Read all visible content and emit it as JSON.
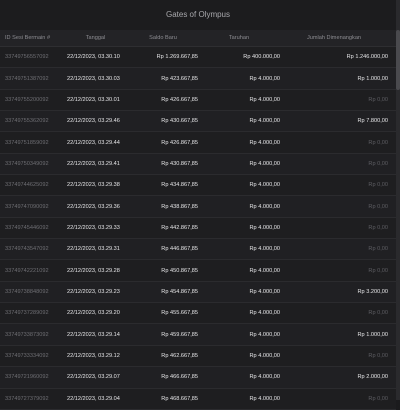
{
  "window": {
    "title": "Gates of Olympus"
  },
  "table": {
    "headers": [
      "ID Sesi Bermain #",
      "Tanggal",
      "Saldo Baru",
      "Taruhan",
      "Jumlah Dimenangkan"
    ],
    "rows": [
      [
        "33749756557092",
        "22/12/2023, 03.30.10",
        "Rp 1.269.667,85",
        "Rp 400.000,00",
        "Rp 1.246.000,00"
      ],
      [
        "33749751387092",
        "22/12/2023, 03.30.03",
        "Rp 423.667,85",
        "Rp 4.000,00",
        "Rp 1.000,00"
      ],
      [
        "33749755200092",
        "22/12/2023, 03.30.01",
        "Rp 426.667,85",
        "Rp 4.000,00",
        "Rp 0,00"
      ],
      [
        "33749755362092",
        "22/12/2023, 03.29.46",
        "Rp 430.667,85",
        "Rp 4.000,00",
        "Rp 7.800,00"
      ],
      [
        "33749751859092",
        "22/12/2023, 03.29.44",
        "Rp 426.867,85",
        "Rp 4.000,00",
        "Rp 0,00"
      ],
      [
        "33749750349092",
        "22/12/2023, 03.29.41",
        "Rp 430.867,85",
        "Rp 4.000,00",
        "Rp 0,00"
      ],
      [
        "33749744625092",
        "22/12/2023, 03.29.38",
        "Rp 434.867,85",
        "Rp 4.000,00",
        "Rp 0,00"
      ],
      [
        "33749747090092",
        "22/12/2023, 03.29.36",
        "Rp 438.867,85",
        "Rp 4.000,00",
        "Rp 0,00"
      ],
      [
        "33749745446092",
        "22/12/2023, 03.29.33",
        "Rp 442.867,85",
        "Rp 4.000,00",
        "Rp 0,00"
      ],
      [
        "33749743547092",
        "22/12/2023, 03.29.31",
        "Rp 446.867,85",
        "Rp 4.000,00",
        "Rp 0,00"
      ],
      [
        "33749742221092",
        "22/12/2023, 03.29.28",
        "Rp 450.867,85",
        "Rp 4.000,00",
        "Rp 0,00"
      ],
      [
        "33749738848092",
        "22/12/2023, 03.29.23",
        "Rp 454.867,85",
        "Rp 4.000,00",
        "Rp 3.200,00"
      ],
      [
        "33749737289092",
        "22/12/2023, 03.29.20",
        "Rp 455.667,85",
        "Rp 4.000,00",
        "Rp 0,00"
      ],
      [
        "33749733873092",
        "22/12/2023, 03.29.14",
        "Rp 459.667,85",
        "Rp 4.000,00",
        "Rp 1.000,00"
      ],
      [
        "33749733334092",
        "22/12/2023, 03.29.12",
        "Rp 462.667,85",
        "Rp 4.000,00",
        "Rp 0,00"
      ],
      [
        "33749721960092",
        "22/12/2023, 03.29.07",
        "Rp 466.667,85",
        "Rp 4.000,00",
        "Rp 2.000,00"
      ],
      [
        "33749727379092",
        "22/12/2023, 03.29.04",
        "Rp 468.667,85",
        "Rp 4.000,00",
        "Rp 0,00"
      ]
    ]
  },
  "colors": {
    "background": "#1e1e20",
    "text": "#e6e6e8",
    "muted": "#6e6e73"
  }
}
